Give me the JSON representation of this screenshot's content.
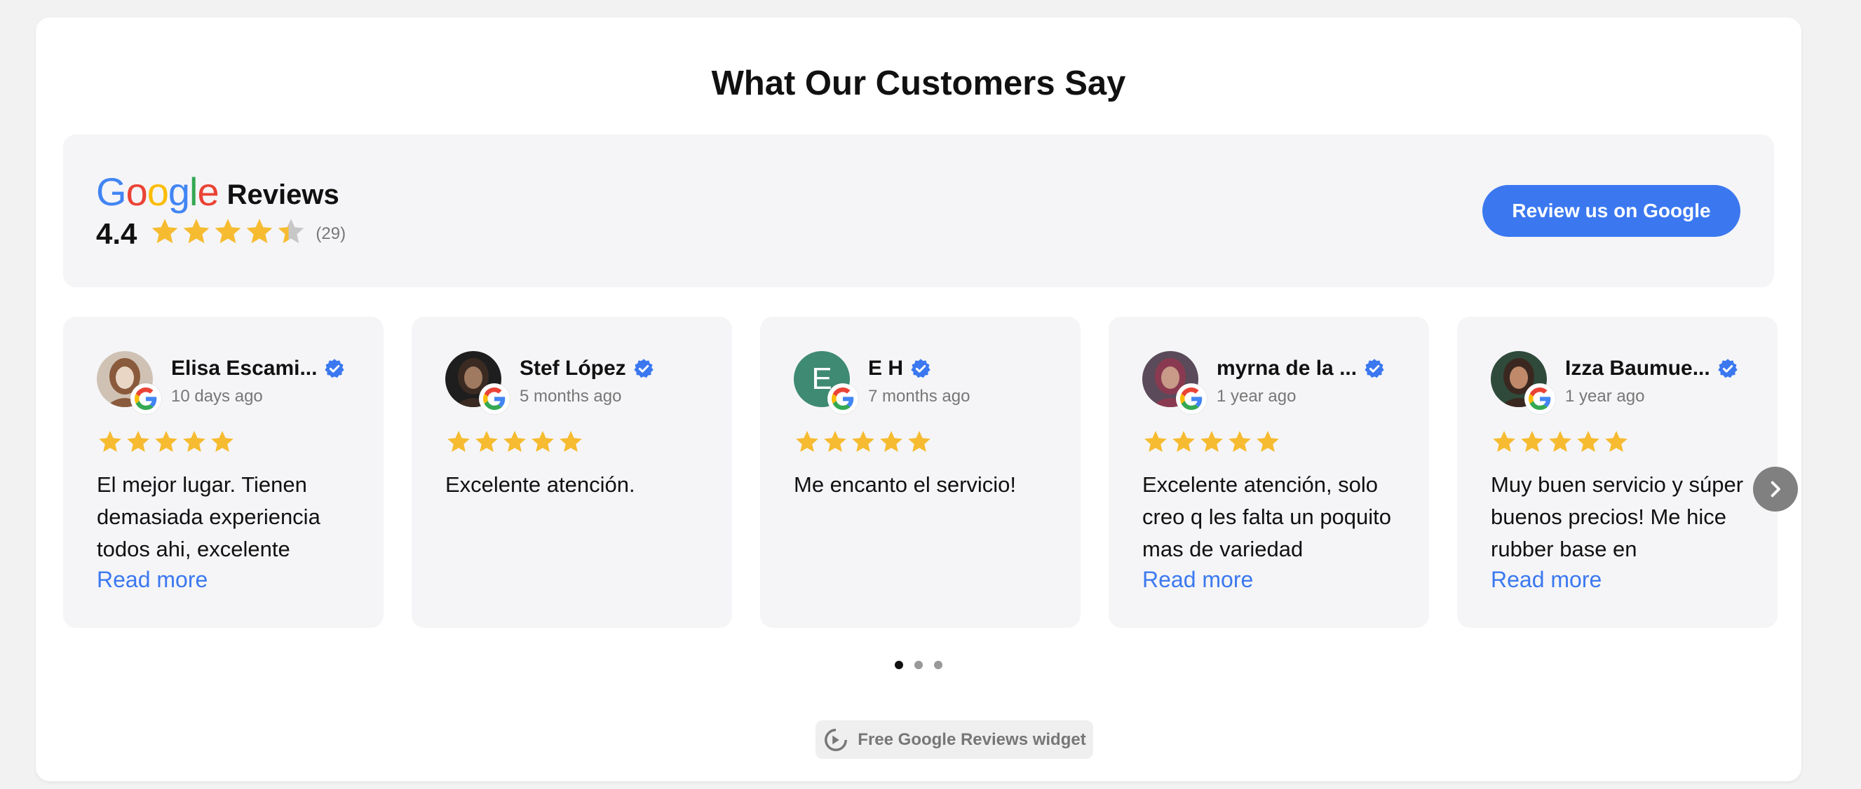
{
  "page": {
    "title": "What Our Customers Say"
  },
  "summary": {
    "brand_word": "Google",
    "brand_suffix": "Reviews",
    "rating": "4.4",
    "rating_value": 4.4,
    "count": "(29)",
    "cta_label": "Review us on Google"
  },
  "colors": {
    "star": "#f6bb30",
    "star_empty": "#c7c7c7",
    "accent": "#3b78f0",
    "verified": "#3b78f0"
  },
  "reviews": [
    {
      "name": "Elisa Escami...",
      "time": "10 days ago",
      "text": "El mejor lugar. Tienen demasiada experiencia todos ahi, excelente",
      "read_more": "Read more",
      "rating": 5,
      "avatar": "photo"
    },
    {
      "name": "Stef López",
      "time": "5 months ago",
      "text": "Excelente atención.",
      "read_more": "",
      "rating": 5,
      "avatar": "photo"
    },
    {
      "name": "E H",
      "time": "7 months ago",
      "text": "Me encanto el servicio!",
      "read_more": "",
      "rating": 5,
      "avatar": "letter",
      "initial": "E"
    },
    {
      "name": "myrna de la ...",
      "time": "1 year ago",
      "text": "Excelente atención, solo creo q les falta un poquito mas de variedad",
      "read_more": "Read more",
      "rating": 5,
      "avatar": "photo"
    },
    {
      "name": "Izza Baumue...",
      "time": "1 year ago",
      "text": "Muy buen servicio y súper buenos precios! Me hice rubber base en",
      "read_more": "Read more",
      "rating": 5,
      "avatar": "photo"
    }
  ],
  "pagination": {
    "pages": 3,
    "active": 0
  },
  "footer": {
    "widget_label": "Free Google Reviews widget"
  },
  "icons": {
    "next": "chevron-right-icon",
    "verified": "verified-badge-icon",
    "google": "google-g-icon",
    "star": "star-icon"
  }
}
